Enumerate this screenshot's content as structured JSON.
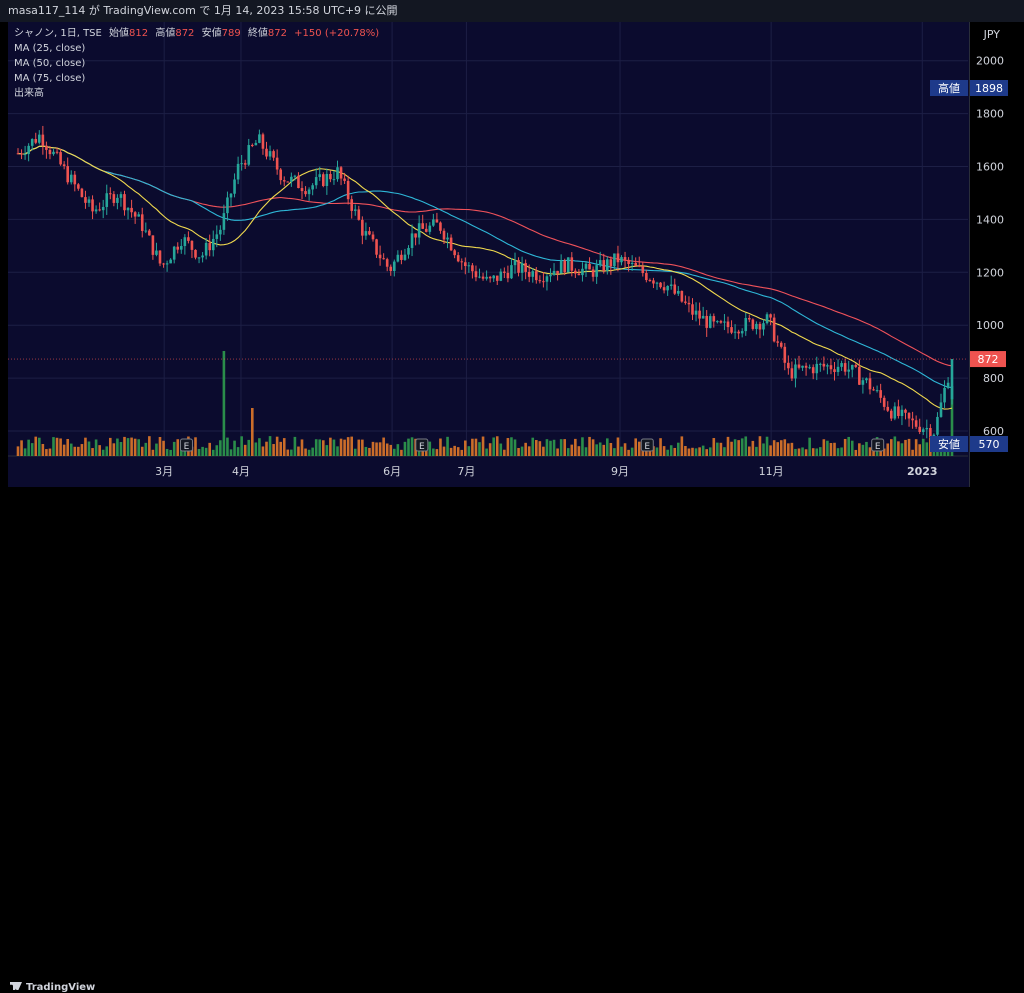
{
  "header": {
    "publish_line": "masa117_114 が TradingView.com で 1月 14, 2023 15:58 UTC+9 に公開"
  },
  "legend": {
    "symbol": "シャノン, 1日, TSE",
    "open_label": "始値",
    "open_value": "812",
    "high_label": "高値",
    "high_value": "872",
    "low_label": "安値",
    "low_value": "789",
    "close_label": "終値",
    "close_value": "872",
    "change": "+150 (+20.78%)",
    "ma25": "MA (25, close)",
    "ma50": "MA (50, close)",
    "ma75": "MA (75, close)",
    "volume": "出来高"
  },
  "axis": {
    "currency": "JPY",
    "ticks": [
      "2000",
      "1800",
      "1600",
      "1400",
      "1200",
      "1000",
      "800",
      "600"
    ],
    "high_tag_label": "高値",
    "high_tag_value": "1898",
    "low_tag_label": "安値",
    "low_tag_value": "570",
    "last_price": "872",
    "months": [
      "3月",
      "4月",
      "6月",
      "7月",
      "9月",
      "11月",
      "2023"
    ]
  },
  "earnings_marker": "E",
  "footer": {
    "brand": "TradingView"
  },
  "colors": {
    "up": "#26a69a",
    "down": "#ef5350",
    "ma25": "#f0d94e",
    "ma50": "#2eb7d7",
    "ma75": "#f0525a",
    "background": "#0b0b2e"
  },
  "chart_data": {
    "type": "candlestick",
    "ylim": [
      570,
      2000
    ],
    "y_axis_position": "right",
    "legend_placement": "top-left",
    "price_path": [
      [
        "2022-01-01",
        1650
      ],
      [
        "2022-01-10",
        1720
      ],
      [
        "2022-01-20",
        1580
      ],
      [
        "2022-01-31",
        1430
      ],
      [
        "2022-02-10",
        1500
      ],
      [
        "2022-02-20",
        1380
      ],
      [
        "2022-02-28",
        1220
      ],
      [
        "2022-03-08",
        1330
      ],
      [
        "2022-03-16",
        1260
      ],
      [
        "2022-03-24",
        1370
      ],
      [
        "2022-03-31",
        1600
      ],
      [
        "2022-04-08",
        1700
      ],
      [
        "2022-04-18",
        1560
      ],
      [
        "2022-04-28",
        1520
      ],
      [
        "2022-05-10",
        1580
      ],
      [
        "2022-05-20",
        1360
      ],
      [
        "2022-05-31",
        1210
      ],
      [
        "2022-06-10",
        1350
      ],
      [
        "2022-06-20",
        1380
      ],
      [
        "2022-06-30",
        1230
      ],
      [
        "2022-07-10",
        1160
      ],
      [
        "2022-07-20",
        1220
      ],
      [
        "2022-07-31",
        1190
      ],
      [
        "2022-08-10",
        1230
      ],
      [
        "2022-08-20",
        1200
      ],
      [
        "2022-08-31",
        1250
      ],
      [
        "2022-09-10",
        1200
      ],
      [
        "2022-09-20",
        1150
      ],
      [
        "2022-09-30",
        1050
      ],
      [
        "2022-10-10",
        990
      ],
      [
        "2022-10-20",
        1000
      ],
      [
        "2022-10-31",
        1020
      ],
      [
        "2022-11-08",
        820
      ],
      [
        "2022-11-18",
        840
      ],
      [
        "2022-11-30",
        850
      ],
      [
        "2022-12-10",
        780
      ],
      [
        "2022-12-20",
        670
      ],
      [
        "2022-12-28",
        630
      ],
      [
        "2023-01-06",
        600
      ],
      [
        "2023-01-13",
        872
      ]
    ],
    "volume_spikes": [
      [
        "2022-03-25",
        "very high"
      ],
      [
        "2022-04-05",
        "high"
      ],
      [
        "2023-01-13",
        "high"
      ]
    ],
    "earnings_dates": [
      "2022-03-10",
      "2022-06-13",
      "2022-09-12",
      "2022-12-14"
    ],
    "series": [
      {
        "name": "MA (25, close)",
        "color": "#f0d94e"
      },
      {
        "name": "MA (50, close)",
        "color": "#2eb7d7"
      },
      {
        "name": "MA (75, close)",
        "color": "#f0525a"
      }
    ]
  }
}
